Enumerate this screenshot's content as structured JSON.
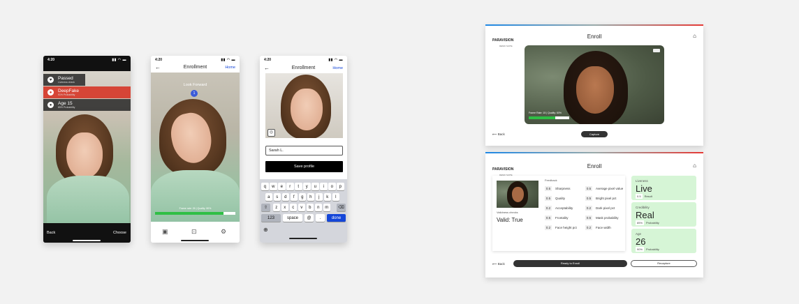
{
  "phone1": {
    "time": "4:20",
    "badges": [
      {
        "title": "Passed",
        "sub": "Liveness check"
      },
      {
        "title": "DeepFake",
        "sub": "91% Probability"
      },
      {
        "title": "Age 15",
        "sub": "85% Probability"
      }
    ],
    "back": "Back",
    "choose": "Choose"
  },
  "phone2": {
    "time": "4:20",
    "title": "Enrollment",
    "home": "Home",
    "instruction": "Look Forward",
    "progress_text": "Frame rate: 26 | Quality: 80%",
    "progress": 0.85
  },
  "phone3": {
    "time": "4:20",
    "title": "Enrollment",
    "home": "Home",
    "name_value": "Sarah L.",
    "save": "Save profile",
    "rows": [
      [
        "q",
        "w",
        "e",
        "r",
        "t",
        "y",
        "u",
        "i",
        "o",
        "p"
      ],
      [
        "a",
        "s",
        "d",
        "f",
        "g",
        "h",
        "j",
        "k",
        "l"
      ],
      [
        "z",
        "x",
        "c",
        "v",
        "b",
        "n",
        "m"
      ]
    ],
    "bottom": {
      "num": "123",
      "space": "space",
      "at": "@",
      "dot": ".",
      "done": "done"
    }
  },
  "enroll_top": {
    "brand": "PARAVISION",
    "brand_sub": "DEMO SUITE",
    "title": "Enroll",
    "overlay_text": "Frame Rate: 15 | Quality: 60%",
    "progress": 0.65,
    "back": "Back",
    "capture": "Capture"
  },
  "enroll_bottom": {
    "brand": "PARAVISION",
    "brand_sub": "DEMO SUITE",
    "title": "Enroll",
    "feedback_label": "Feedback",
    "validness_label": "Validness checks",
    "valid_text": "Valid: True",
    "feedback": [
      {
        "v": "0.5",
        "name": "Sharpness"
      },
      {
        "v": "0.5",
        "name": "Average pixel value"
      },
      {
        "v": "0.5",
        "name": "Quality"
      },
      {
        "v": "0.5",
        "name": "Bright pixel pct"
      },
      {
        "v": "0.2",
        "name": "Acceptability"
      },
      {
        "v": "0.2",
        "name": "Dark pixel pct"
      },
      {
        "v": "0.5",
        "name": "Frontality"
      },
      {
        "v": "0.5",
        "name": "Mask probability"
      },
      {
        "v": "0.2",
        "name": "Face height pct"
      },
      {
        "v": "0.2",
        "name": "Face width"
      }
    ],
    "cards": [
      {
        "label": "Liveness",
        "big": "Live",
        "v": "0.5",
        "sub": "Result"
      },
      {
        "label": "Credibility",
        "big": "Real",
        "v": "85%",
        "sub": "Probability"
      },
      {
        "label": "Age",
        "big": "26",
        "v": "90%",
        "sub": "Probability"
      }
    ],
    "back": "Back",
    "ready": "Ready to Enroll",
    "recapture": "Recapture"
  },
  "colors": {
    "accent_blue": "#1446d8",
    "green": "#2fbf45",
    "red_badge": "#d63a2a",
    "card_green": "#d6f5d6"
  }
}
